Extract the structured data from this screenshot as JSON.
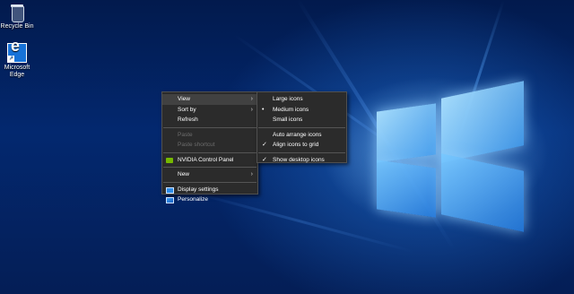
{
  "desktop": {
    "icons": [
      {
        "label": "Recycle Bin",
        "icon": "recycle-bin-icon"
      },
      {
        "label": "Microsoft Edge",
        "icon": "edge-icon"
      }
    ]
  },
  "context_menu": {
    "view": "View",
    "sort_by": "Sort by",
    "refresh": "Refresh",
    "paste": "Paste",
    "paste_shortcut": "Paste shortcut",
    "nvidia": "NVIDIA Control Panel",
    "new": "New",
    "display_settings": "Display settings",
    "personalize": "Personalize",
    "arrow_glyph": "›"
  },
  "view_submenu": {
    "large_icons": "Large icons",
    "medium_icons": "Medium icons",
    "small_icons": "Small icons",
    "auto_arrange": "Auto arrange icons",
    "align_to_grid": "Align icons to grid",
    "show_desktop_icons": "Show desktop icons",
    "bullet_glyph": "•",
    "check_glyph": "✓"
  },
  "colors": {
    "menu_bg": "#2b2b2b",
    "menu_hover": "#414141",
    "disabled_text": "#6d6d6d",
    "nvidia_green": "#76b900"
  }
}
